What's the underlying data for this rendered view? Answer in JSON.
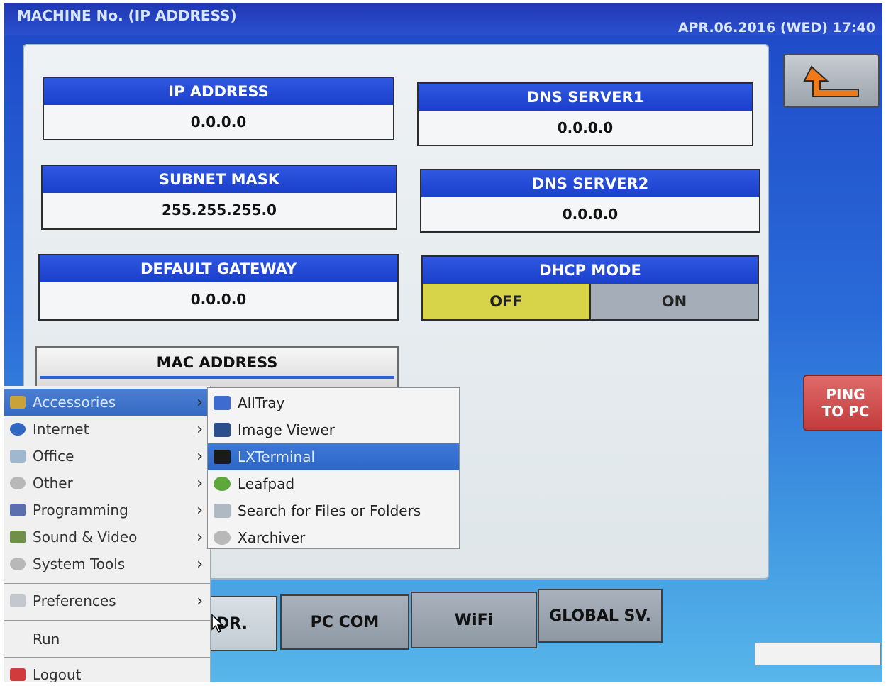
{
  "header": {
    "title": "MACHINE No. (IP ADDRESS)",
    "datetime": "APR.06.2016 (WED)  17:40"
  },
  "fields": {
    "ip": {
      "label": "IP ADDRESS",
      "value": "0.0.0.0"
    },
    "dns1": {
      "label": "DNS SERVER1",
      "value": "0.0.0.0"
    },
    "subnet": {
      "label": "SUBNET MASK",
      "value": "255.255.255.0"
    },
    "dns2": {
      "label": "DNS SERVER2",
      "value": "0.0.0.0"
    },
    "gateway": {
      "label": "DEFAULT GATEWAY",
      "value": "0.0.0.0"
    },
    "dhcp": {
      "label": "DHCP MODE",
      "off": "OFF",
      "on": "ON",
      "selected": "OFF"
    },
    "mac": {
      "label": "MAC ADDRESS"
    }
  },
  "buttons": {
    "ping_line1": "PING",
    "ping_line2": "TO PC",
    "back_icon": "return-arrow-icon"
  },
  "tabs": [
    {
      "label": "DR."
    },
    {
      "label": "PC COM"
    },
    {
      "label": "WiFi"
    },
    {
      "label": "GLOBAL SV."
    }
  ],
  "menu": {
    "items": [
      {
        "label": "Accessories",
        "icon": "accessories-icon"
      },
      {
        "label": "Internet",
        "icon": "internet-icon"
      },
      {
        "label": "Office",
        "icon": "office-icon"
      },
      {
        "label": "Other",
        "icon": "other-icon"
      },
      {
        "label": "Programming",
        "icon": "programming-icon"
      },
      {
        "label": "Sound & Video",
        "icon": "sound-video-icon"
      },
      {
        "label": "System Tools",
        "icon": "system-tools-icon"
      },
      {
        "label": "Preferences",
        "icon": "preferences-icon"
      },
      {
        "label": "Run"
      },
      {
        "label": "Logout",
        "icon": "logout-icon"
      }
    ],
    "submenu": [
      {
        "label": "AllTray",
        "icon": "alltray-icon"
      },
      {
        "label": "Image Viewer",
        "icon": "image-viewer-icon"
      },
      {
        "label": "LXTerminal",
        "icon": "terminal-icon"
      },
      {
        "label": "Leafpad",
        "icon": "leafpad-icon"
      },
      {
        "label": "Search for Files or Folders",
        "icon": "search-icon"
      },
      {
        "label": "Xarchiver",
        "icon": "archive-icon"
      }
    ]
  },
  "colors": {
    "header_blue": "#1a3fcc",
    "dhcp_selected": "#d7d44a",
    "menu_highlight": "#356ac4",
    "ping_red": "#c23b3b"
  }
}
